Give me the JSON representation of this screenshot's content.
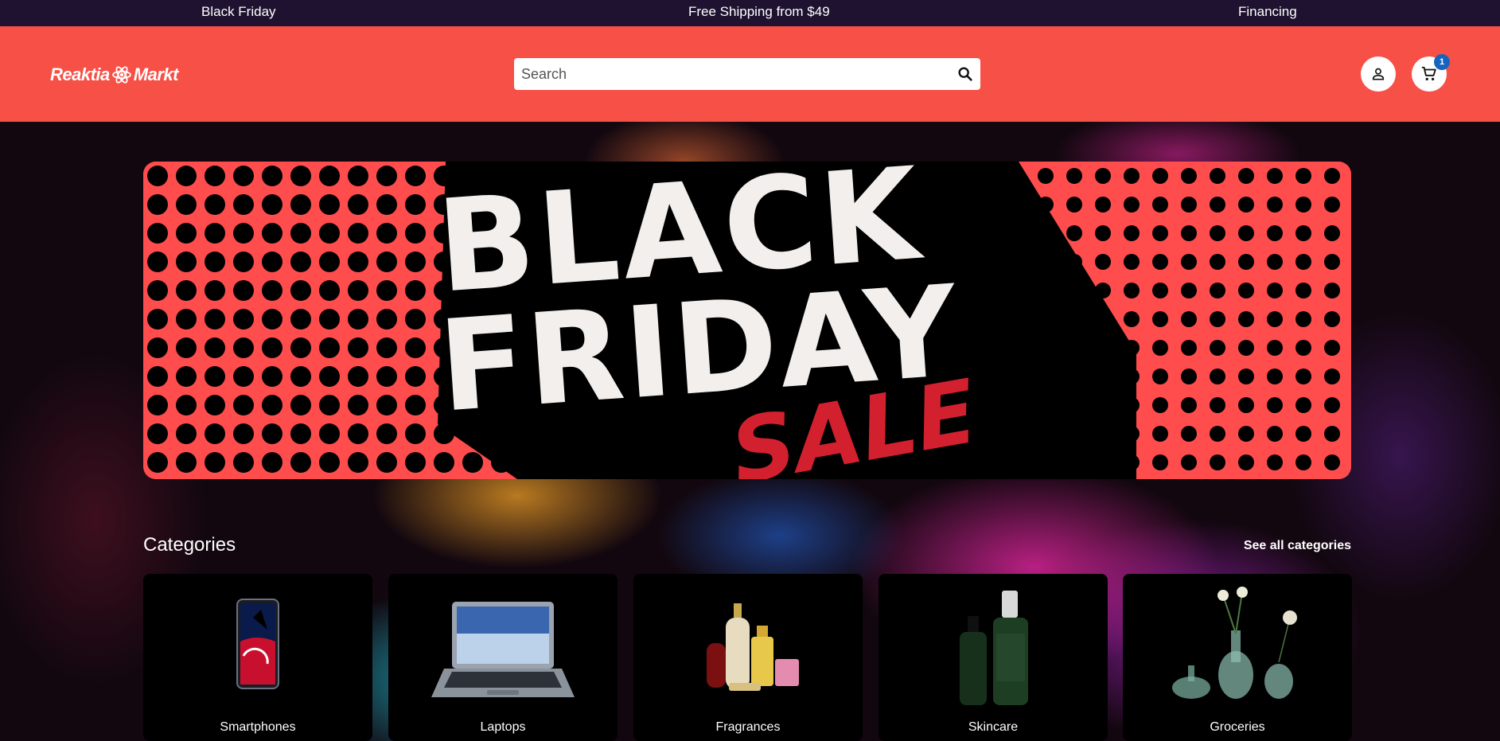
{
  "topbar": {
    "links": [
      "Black Friday",
      "Free Shipping from $49",
      "Financing"
    ]
  },
  "header": {
    "logo_text_left": "Reaktia",
    "logo_text_right": "Markt",
    "search_placeholder": "Search",
    "cart_count": "1",
    "brand_color": "#f65047"
  },
  "banner": {
    "line1": "BLACK",
    "line2": "FRIDAY",
    "line3": "SALE"
  },
  "categories": {
    "title": "Categories",
    "see_all": "See all categories",
    "items": [
      {
        "label": "Smartphones",
        "icon": "smartphone-image"
      },
      {
        "label": "Laptops",
        "icon": "laptop-image"
      },
      {
        "label": "Fragrances",
        "icon": "perfume-bottles-image"
      },
      {
        "label": "Skincare",
        "icon": "skincare-bottles-image"
      },
      {
        "label": "Groceries",
        "icon": "flower-vases-image"
      }
    ]
  }
}
